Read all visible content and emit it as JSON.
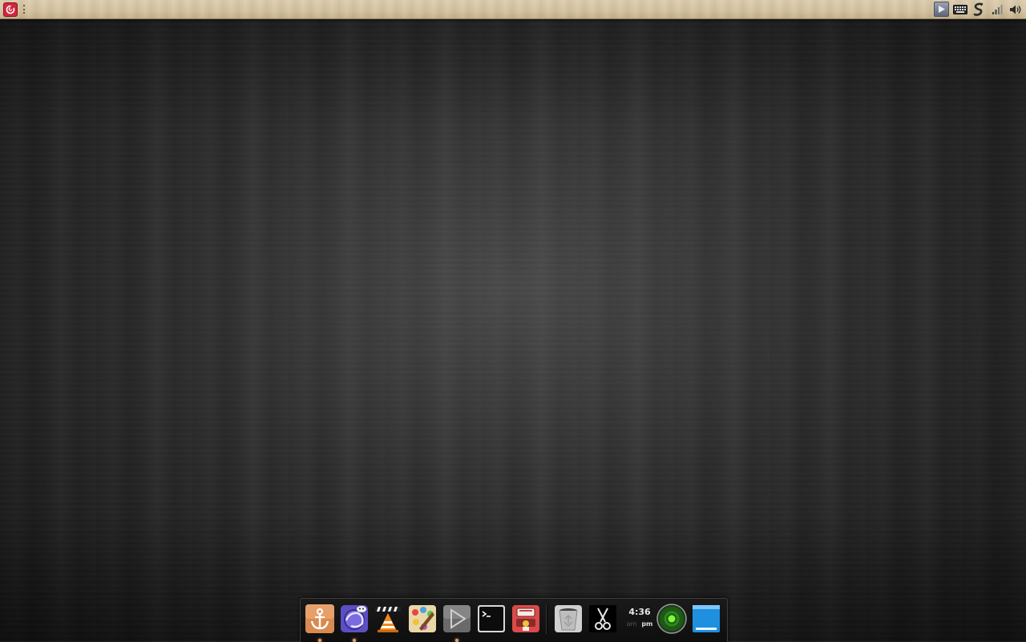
{
  "top_panel": {
    "menu_icon": "debian-swirl-icon",
    "tray_icons": [
      "media-play-icon",
      "keyboard-icon",
      "dropbox-sync-icon",
      "signal-icon",
      "volume-icon"
    ]
  },
  "dock": {
    "items": [
      {
        "name": "anchor-app-icon",
        "running": true
      },
      {
        "name": "firefox-browser-icon",
        "running": true
      },
      {
        "name": "vlc-media-player-icon",
        "running": false
      },
      {
        "name": "paint-app-icon",
        "running": false
      },
      {
        "name": "media-player-icon",
        "running": true
      },
      {
        "name": "terminal-icon",
        "running": false
      },
      {
        "name": "package-manager-icon",
        "running": false
      },
      {
        "name": "trash-icon",
        "running": false
      },
      {
        "name": "screenshot-scissors-icon",
        "running": false
      },
      {
        "name": "network-status-icon",
        "running": false
      },
      {
        "name": "show-desktop-icon",
        "running": false
      }
    ],
    "clock": {
      "time": "4:36",
      "am": "am",
      "pm": "pm"
    }
  },
  "colors": {
    "panel_wood": "#d4c29f",
    "desktop_bg": "#2e2e2e",
    "dock_bg": "#121212",
    "indicator": "#e0a06a"
  }
}
